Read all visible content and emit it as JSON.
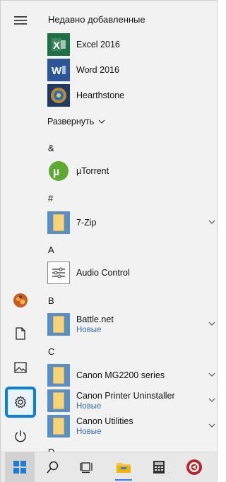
{
  "recent": {
    "title": "Недавно добавленные",
    "items": [
      {
        "label": "Excel 2016",
        "icon": "excel-icon"
      },
      {
        "label": "Word 2016",
        "icon": "word-icon"
      },
      {
        "label": "Hearthstone",
        "icon": "hearthstone-icon"
      }
    ]
  },
  "expand_label": "Развернуть",
  "groups": {
    "amp": {
      "letter": "&",
      "items": [
        {
          "label": "µTorrent",
          "icon": "utorrent-icon"
        }
      ]
    },
    "hash": {
      "letter": "#",
      "items": [
        {
          "label": "7-Zip",
          "icon": "folder-icon"
        }
      ]
    },
    "a": {
      "letter": "A",
      "items": [
        {
          "label": "Audio Control",
          "icon": "audio-control-icon"
        }
      ]
    },
    "b": {
      "letter": "B",
      "items": [
        {
          "label": "Battle.net",
          "sublabel": "Новые",
          "icon": "folder-icon"
        }
      ]
    },
    "c": {
      "letter": "C",
      "items": [
        {
          "label": "Canon MG2200 series",
          "icon": "folder-icon"
        },
        {
          "label": "Canon Printer Uninstaller",
          "sublabel": "Новые",
          "icon": "folder-icon"
        },
        {
          "label": "Canon Utilities",
          "sublabel": "Новые",
          "icon": "folder-icon"
        }
      ]
    },
    "d": {
      "letter": "D"
    }
  },
  "rail": [
    "hamburger-icon",
    "avatar",
    "document-icon",
    "pictures-icon",
    "settings-icon",
    "power-icon"
  ],
  "taskbar": [
    "windows-start-icon",
    "search-icon",
    "task-view-icon",
    "file-explorer-icon",
    "calculator-icon",
    "media-app-icon"
  ],
  "colors": {
    "accent": "#0a7fe0",
    "folder_tile": "#5a8ec6",
    "new_badge": "#3b6fb0"
  }
}
